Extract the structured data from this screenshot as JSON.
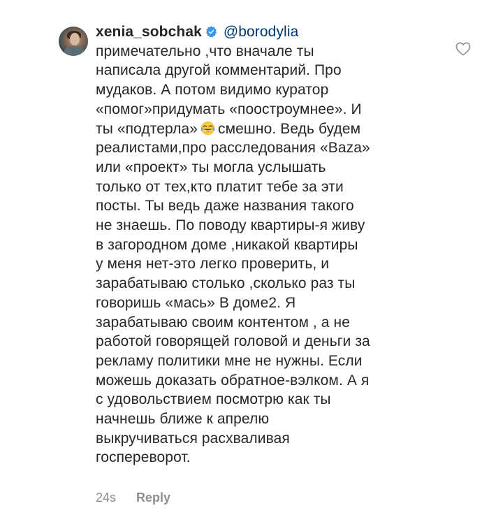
{
  "comment": {
    "username": "xenia_sobchak",
    "mention": "@borodylia",
    "text_part1": "примечательно ,что вначале ты\nнаписала другой комментарий. Про\nмудаков. А потом видимо куратор\n«помог»придумать «поостроумнее». И\nты «подтерла»",
    "text_part2": "смешно. Ведь будем\nреалистами,про расследования «Baza»\nили «проект» ты могла услышать\nтолько от тех,кто платит тебе за эти\nпосты. Ты ведь даже названия такого\nне знаешь. По поводу квартиры-я живу\nв загородном доме ,никакой квартиры\nу меня нет-это легко проверить, и\nзарабатываю столько ,сколько раз ты\nговоришь «мась» В доме2. Я\nзарабатываю своим контентом , а не\nработой говорящей головой и деньги за\nрекламу политики мне не нужны. Если\nможешь доказать обратное-вэлком. А я\nс удовольствием посмотрю как ты\nначнешь ближе к апрелю\nвыкручиваться расхваливая\nгоспереворот.",
    "emoji_icon": "tears-of-joy-emoji",
    "time": "24s",
    "reply_label": "Reply",
    "verified_icon": "verified-badge-icon",
    "like_icon": "heart-outline-icon"
  },
  "colors": {
    "text": "#262626",
    "mention": "#00376b",
    "meta": "#8e8e8e",
    "verified": "#3897f0"
  }
}
